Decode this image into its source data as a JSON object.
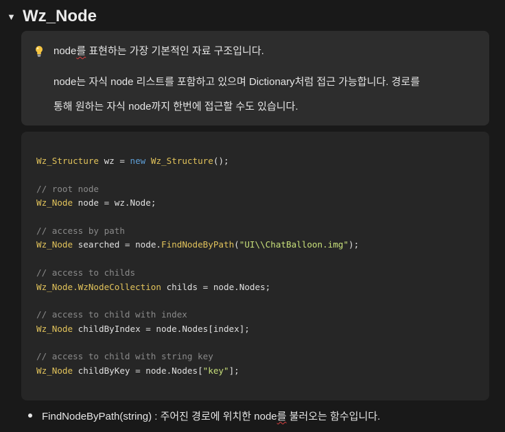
{
  "toggle": {
    "title": "Wz_Node",
    "arrow": "▼"
  },
  "callout": {
    "icon": "lightbulb-icon",
    "line1_word": "node",
    "line1_marked": "를",
    "line1_rest": " 표현하는 가장 기본적인 자료 구조입니다.",
    "line2": "node는 자식 node 리스트를 포함하고 있으며 Dictionary처럼 접근 가능합니다. 경로를",
    "line3": "통해 원하는 자식 node까지 한번에 접근할 수도 있습니다."
  },
  "code": {
    "l1": {
      "type1": "Wz_Structure",
      "var": " wz ",
      "op": "=",
      "kw": " new ",
      "type2": "Wz_Structure",
      "rest": "();"
    },
    "c1": "// root node",
    "l2": {
      "type": "Wz_Node",
      "var": " node ",
      "op": "=",
      "rest": " wz.Node;"
    },
    "c2": "// access by path",
    "l3": {
      "type": "Wz_Node",
      "var": " searched ",
      "op": "=",
      "obj": " node.",
      "fn": "FindNodeByPath",
      "p1": "(",
      "str": "\"UI\\\\ChatBalloon.img\"",
      "p2": ");"
    },
    "c3": "// access to childs",
    "l4": {
      "type": "Wz_Node.WzNodeCollection",
      "var": " childs ",
      "op": "=",
      "rest": " node.Nodes;"
    },
    "c4": "// access to child with index",
    "l5": {
      "type": "Wz_Node",
      "var": " childByIndex ",
      "op": "=",
      "rest": " node.Nodes[index];"
    },
    "c5": "// access to child with string key",
    "l6": {
      "type": "Wz_Node",
      "var": " childByKey ",
      "op": "=",
      "obj": " node.Nodes[",
      "str": "\"key\"",
      "p2": "];"
    }
  },
  "bullet": {
    "text_pre": "FindNodeByPath(string) : 주어진 경로에 위치한 node",
    "text_marked": "를",
    "text_post": " 불러오는 함수입니다."
  },
  "colors": {
    "background": "#191919",
    "callout_bg": "#2d2d2d",
    "code_bg": "#262626",
    "type": "#e2c35b",
    "keyword": "#5e9ed6",
    "string": "#c8e07a",
    "comment": "#8a8a8a"
  }
}
